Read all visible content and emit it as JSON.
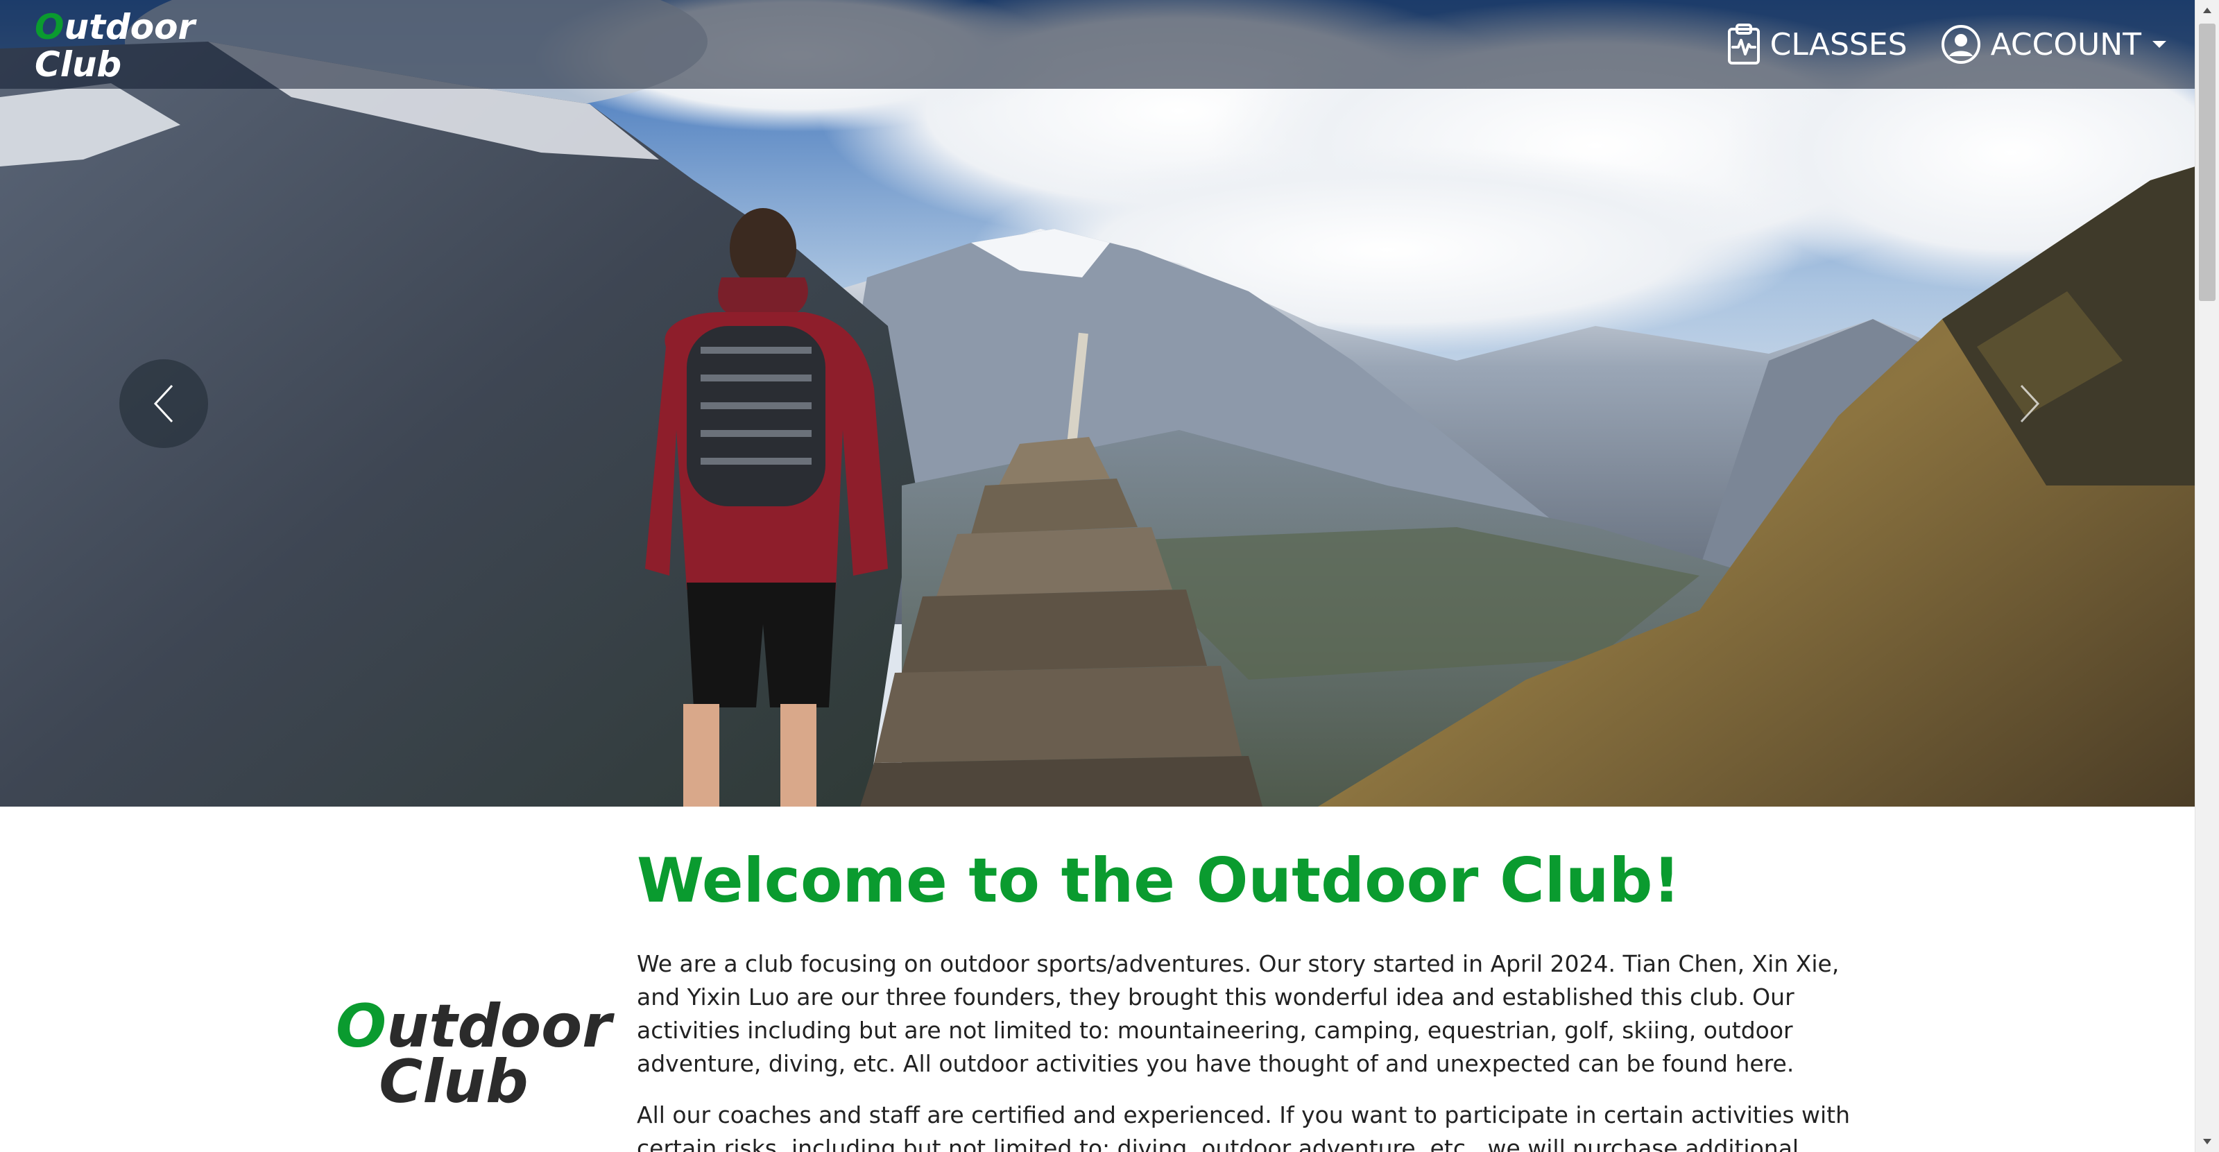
{
  "brand": {
    "first_letter": "O",
    "rest_line1": "utdoor",
    "line2": "Club"
  },
  "nav": {
    "classes_label": "CLASSES",
    "account_label": "ACCOUNT",
    "icons": {
      "classes": "clipboard-pulse-icon",
      "account": "user-circle-icon",
      "caret": "caret-down-icon"
    }
  },
  "carousel": {
    "prev_icon": "chevron-left-icon",
    "next_icon": "chevron-right-icon"
  },
  "side_logo": {
    "first_letter": "O",
    "rest_line1": "utdoor",
    "line2": "Club"
  },
  "main": {
    "title": "Welcome to the Outdoor Club!",
    "paragraph1": "We are a club focusing on outdoor sports/adventures. Our story started in April 2024. Tian Chen, Xin Xie, and Yixin Luo are our three founders, they brought this wonderful idea and established this club. Our activities including but are not limited to: mountaineering, camping, equestrian, golf, skiing, outdoor adventure, diving, etc. All outdoor activities you have thought of and unexpected can be found here.",
    "paragraph2": "All our coaches and staff are certified and experienced. If you want to participate in certain activities with certain risks, including but not limited to: diving, outdoor adventure, etc., we will purchase additional accident insurance"
  },
  "colors": {
    "brand_green": "#0a9b2f",
    "nav_bg": "#0f192d",
    "text": "#222222"
  }
}
